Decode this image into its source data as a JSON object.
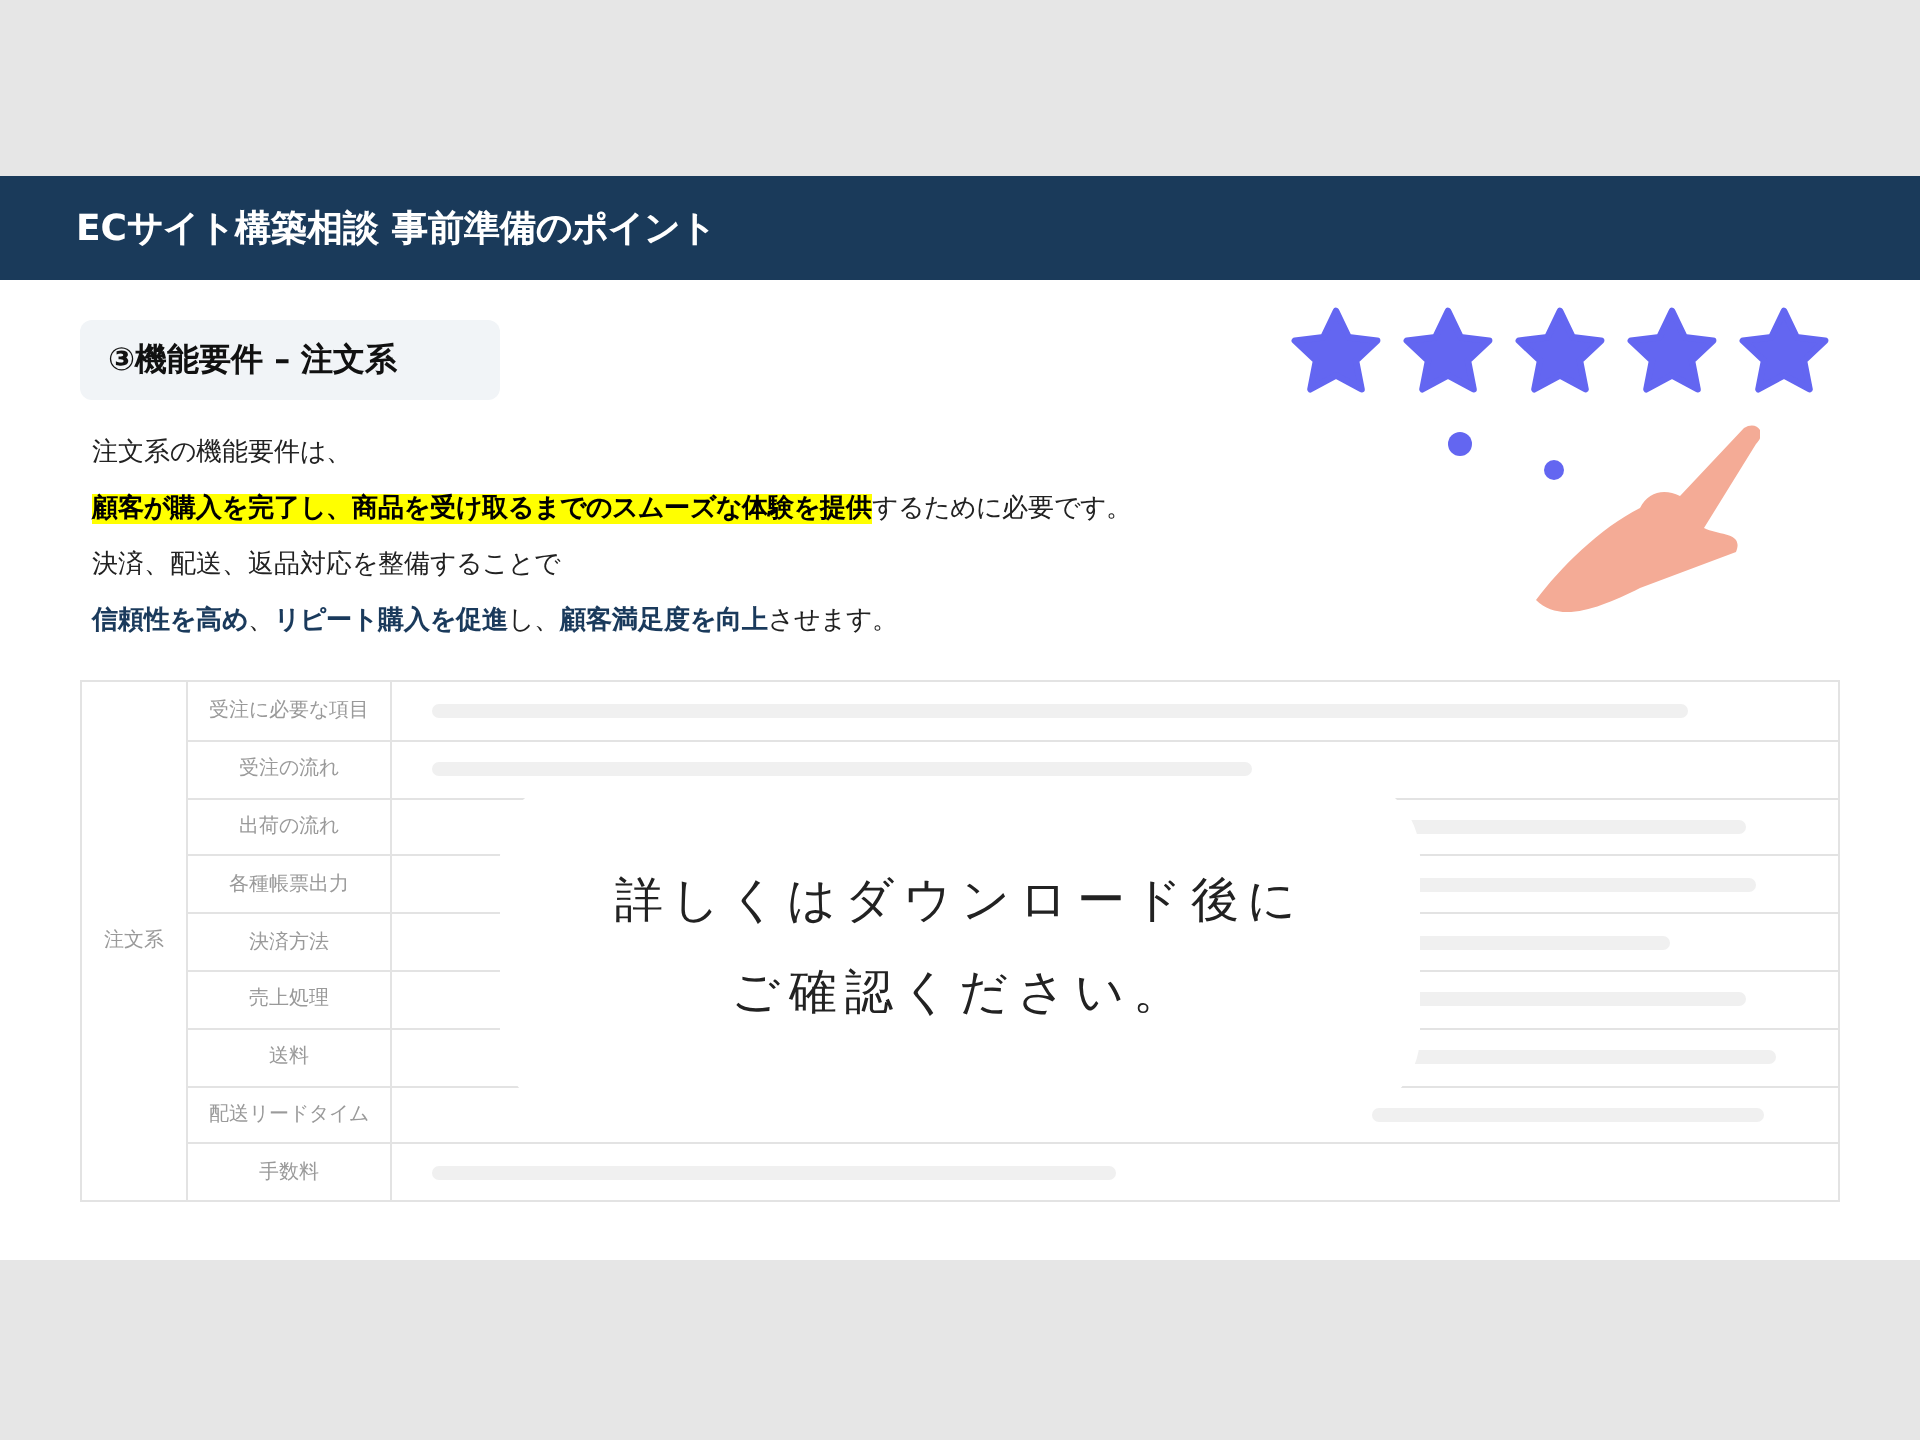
{
  "header": {
    "title": "ECサイト構築相談 事前準備のポイント"
  },
  "section": {
    "title": "③機能要件 – 注文系"
  },
  "paragraphs": [
    [
      {
        "kind": "plain",
        "text": "注文系の機能要件は、"
      }
    ],
    [
      {
        "kind": "highlight",
        "text": "顧客が購入を完了し、商品を受け取るまでのスムーズな体験を提供"
      },
      {
        "kind": "plain",
        "text": "するために必要です。"
      }
    ],
    [
      {
        "kind": "plain",
        "text": "決済、配送、返品対応を整備することで"
      }
    ],
    [
      {
        "kind": "emphasis",
        "text": "信頼性を高め"
      },
      {
        "kind": "plain",
        "text": "、"
      },
      {
        "kind": "emphasis",
        "text": "リピート購入を促進"
      },
      {
        "kind": "plain",
        "text": "し、"
      },
      {
        "kind": "emphasis",
        "text": "顧客満足度を向上"
      },
      {
        "kind": "plain",
        "text": "させます。"
      }
    ]
  ],
  "rating": {
    "stars": 5
  },
  "table": {
    "group": "注文系",
    "rows": [
      {
        "label": "受注に必要な項目"
      },
      {
        "label": "受注の流れ"
      },
      {
        "label": "出荷の流れ"
      },
      {
        "label": "各種帳票出力"
      },
      {
        "label": "決済方法"
      },
      {
        "label": "売上処理"
      },
      {
        "label": "送料"
      },
      {
        "label": "配送リードタイム"
      },
      {
        "label": "手数料"
      }
    ]
  },
  "overlay": {
    "lines": [
      "詳しくはダウンロード後に",
      "ご確認ください。"
    ]
  }
}
